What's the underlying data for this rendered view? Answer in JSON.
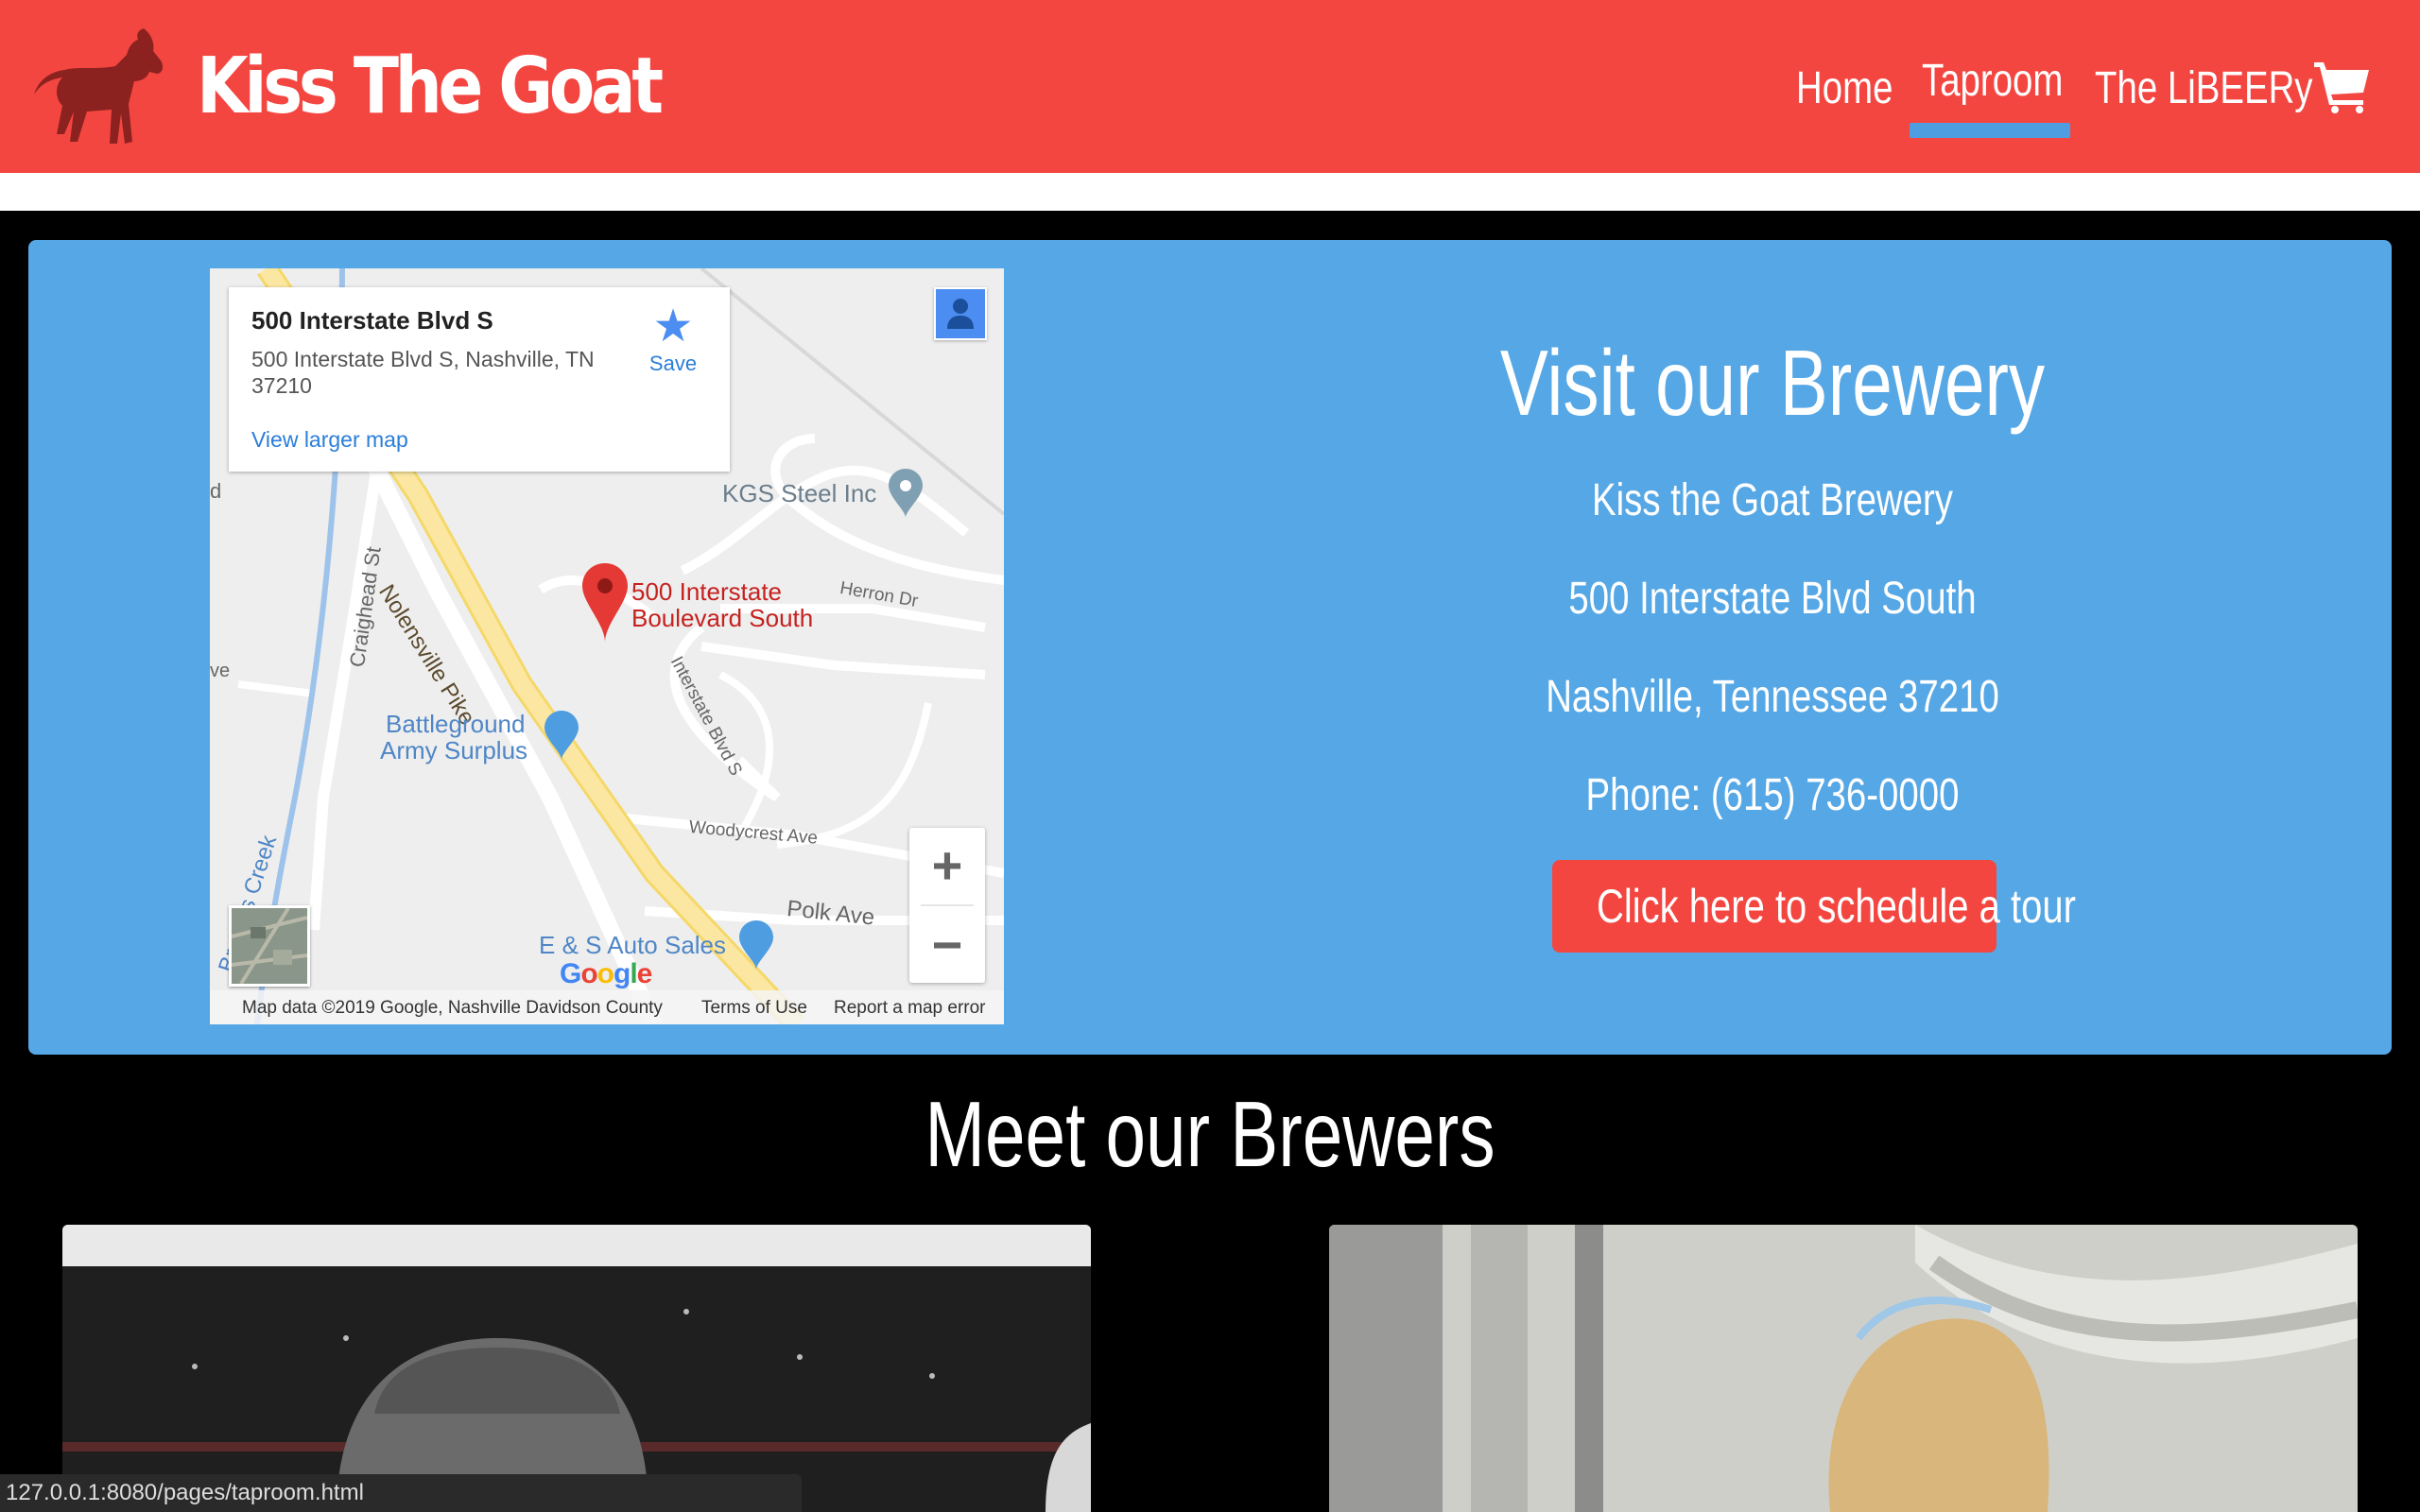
{
  "header": {
    "brand": "Kiss The Goat",
    "logo_icon": "goat-icon",
    "nav": [
      {
        "label": "Home",
        "active": false
      },
      {
        "label": "Taproom",
        "active": true
      },
      {
        "label": "The LiBEERy",
        "active": false
      }
    ],
    "cart_icon": "cart-icon",
    "colors": {
      "header_bg": "#f44641",
      "active_underline": "#4f9de1"
    }
  },
  "map": {
    "info": {
      "title": "500 Interstate Blvd S",
      "address": "500 Interstate Blvd S, Nashville, TN 37210",
      "save_label": "Save",
      "larger_map_link": "View larger map"
    },
    "labels": {
      "kgs": "KGS Steel Inc",
      "herron": "Herron Dr",
      "pin_line1": "500 Interstate",
      "pin_line2": "Boulevard South",
      "nolensville": "Nolensville Pike",
      "craighead": "Craighead St",
      "interstate": "Interstate Blvd S",
      "battleground1": "Battleground",
      "battleground2": "Army Surplus",
      "woodycrest": "Woodycrest Ave",
      "polk": "Polk Ave",
      "es_auto": "E & S Auto Sales",
      "creek": "Browns Creek",
      "d_fragment": "d",
      "ve_fragment": "ve"
    },
    "google_logo": "Google",
    "footer": {
      "data": "Map data ©2019 Google, Nashville Davidson County",
      "terms": "Terms of Use",
      "report": "Report a map error"
    },
    "zoom_in": "+",
    "zoom_out": "−"
  },
  "visit": {
    "title": "Visit our Brewery",
    "name": "Kiss the Goat Brewery",
    "street": "500 Interstate Blvd South",
    "city": "Nashville, Tennessee 37210",
    "phone": "Phone: (615) 736-0000",
    "tour_button": "Click here to schedule a tour",
    "panel_color": "#56a7e5"
  },
  "brewers": {
    "title": "Meet our Brewers"
  },
  "status_bar": {
    "url": "127.0.0.1:8080/pages/taproom.html"
  }
}
